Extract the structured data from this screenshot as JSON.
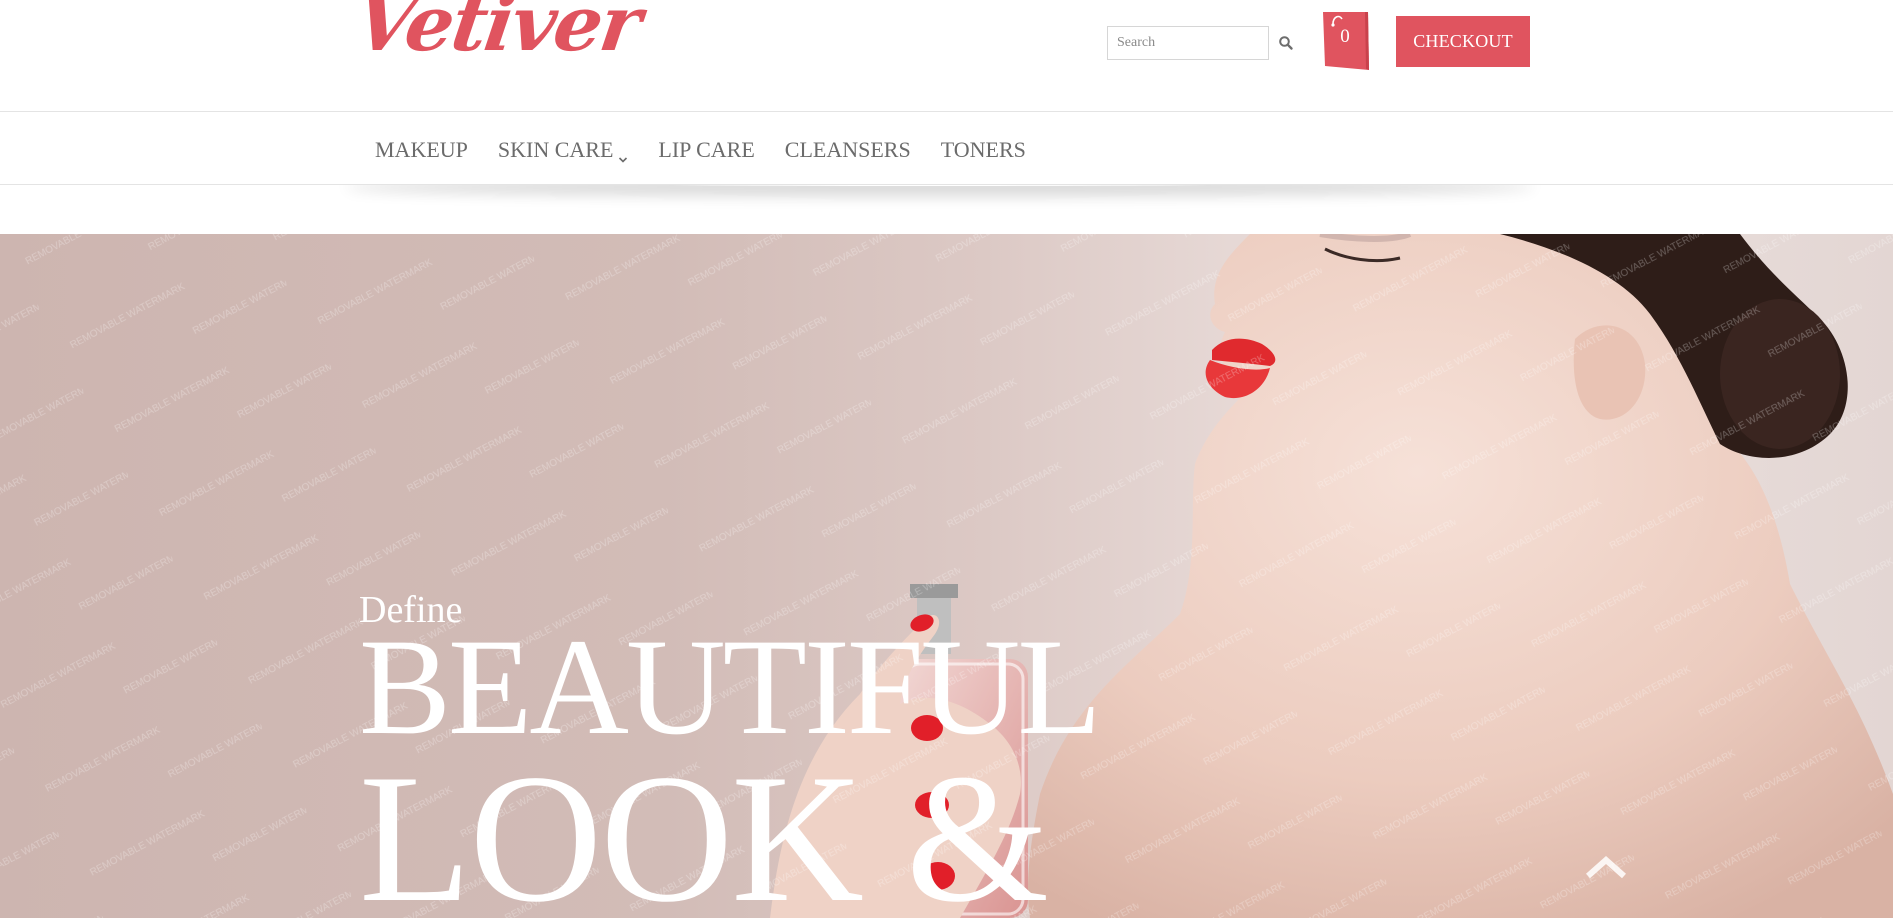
{
  "brand": {
    "logo_text": "Vetiver",
    "accent_color": "#e0545f"
  },
  "header": {
    "search": {
      "placeholder": "Search",
      "value": "",
      "icon": "search-icon"
    },
    "cart": {
      "count": "0",
      "icon": "shopping-bag-icon"
    },
    "checkout_label": "CHECKOUT"
  },
  "nav": {
    "items": [
      {
        "label": "MAKEUP"
      },
      {
        "label": "SKIN CARE",
        "icon": "chevron-down-icon"
      },
      {
        "label": "LIP CARE"
      },
      {
        "label": "CLEANSERS"
      },
      {
        "label": "TONERS"
      }
    ]
  },
  "hero": {
    "kicker": "Define",
    "headline_line1": "BEAUTIFUL",
    "headline_line2": "LOOK &",
    "watermark_text": "REMOVABLE WATERMARK",
    "scroll_top_icon": "chevron-up-icon"
  }
}
